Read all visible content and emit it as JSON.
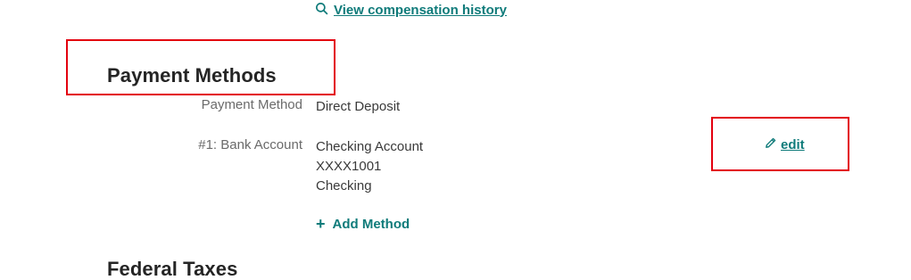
{
  "history_link": {
    "label": "View compensation history",
    "icon": "search-icon"
  },
  "payment_methods": {
    "title": "Payment Methods",
    "rows": [
      {
        "label": "Payment Method",
        "lines": [
          "Direct Deposit"
        ]
      },
      {
        "label": "#1: Bank Account",
        "lines": [
          "Checking Account",
          "XXXX1001",
          "Checking"
        ]
      }
    ],
    "edit_label": "edit",
    "add_label": "Add Method"
  },
  "federal_taxes": {
    "title": "Federal Taxes"
  },
  "colors": {
    "accent": "#0f7b7a",
    "highlight": "#e3000f"
  }
}
